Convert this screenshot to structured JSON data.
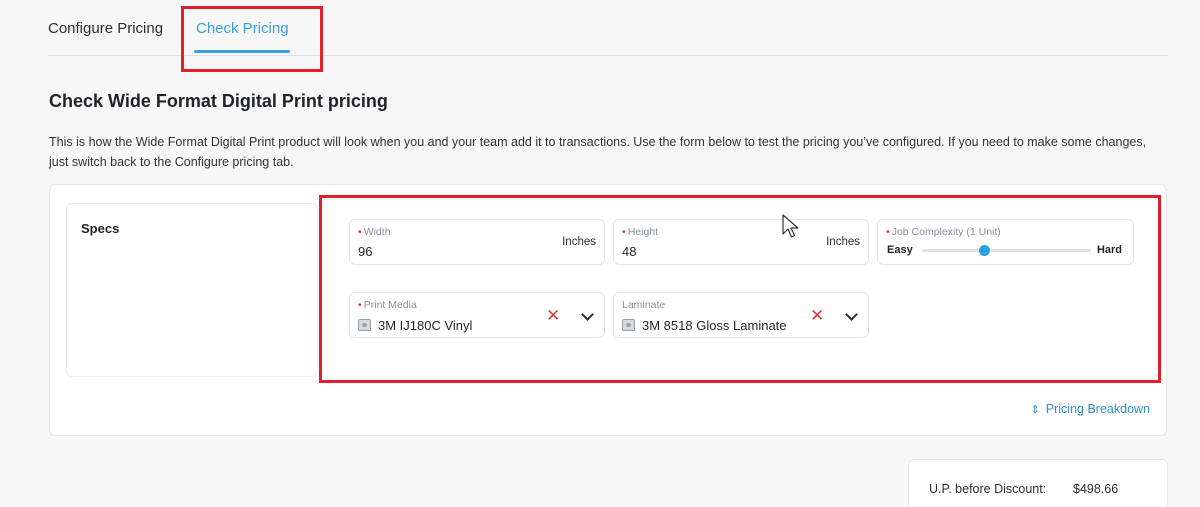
{
  "tabs": [
    {
      "label": "Configure Pricing",
      "active": false
    },
    {
      "label": "Check Pricing",
      "active": true
    }
  ],
  "page": {
    "title": "Check Wide Format Digital Print pricing",
    "description": "This is how the Wide Format Digital Print product will look when you and your team add it to transactions. Use the form below to test the pricing you’ve configured. If you need to make some changes, just switch back to the Configure pricing tab."
  },
  "specs": {
    "label": "Specs",
    "width": {
      "label": "Width",
      "value": "96",
      "unit": "Inches",
      "required": true
    },
    "height": {
      "label": "Height",
      "value": "48",
      "unit": "Inches",
      "required": true
    },
    "job_complexity": {
      "label": "Job Complexity (1 Unit)",
      "min_label": "Easy",
      "max_label": "Hard",
      "required": true,
      "level": 0.36
    },
    "print_media": {
      "label": "Print Media",
      "value": "3M IJ180C Vinyl",
      "required": true
    },
    "laminate": {
      "label": "Laminate",
      "value": "3M 8518 Gloss Laminate",
      "required": false
    }
  },
  "pricing_breakdown_label": "Pricing Breakdown",
  "summary": {
    "label": "U.P. before Discount:",
    "value": "$498.66"
  },
  "colors": {
    "accent": "#3aa0d8",
    "highlight": "#e0202a",
    "clear": "#d93b3b"
  }
}
